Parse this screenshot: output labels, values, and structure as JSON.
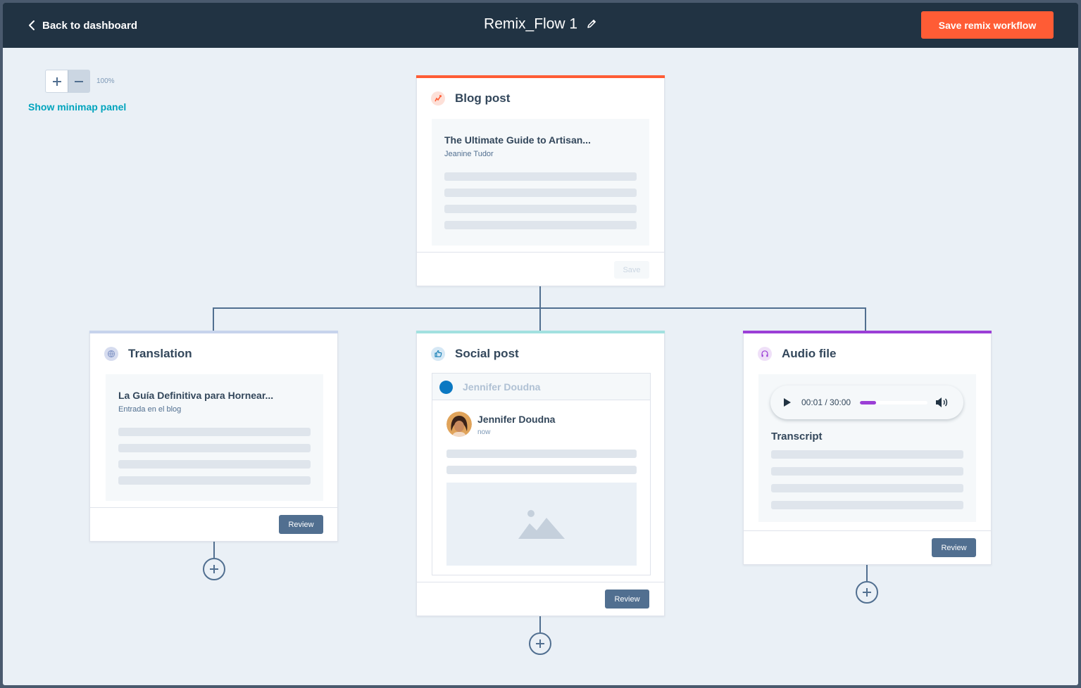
{
  "header": {
    "back_label": "Back to dashboard",
    "title": "Remix_Flow 1",
    "save_label": "Save remix workflow"
  },
  "canvas": {
    "zoom_level": "100%",
    "minimap_label": "Show minimap panel"
  },
  "cards": {
    "blog": {
      "title": "Blog post",
      "accent": "#ff5c35",
      "doc_title": "The Ultimate Guide to Artisan...",
      "doc_author": "Jeanine Tudor",
      "save_label": "Save"
    },
    "translation": {
      "title": "Translation",
      "accent": "#c7d3ec",
      "doc_title": "La Guía Definitiva para Hornear...",
      "doc_sub": "Entrada en el blog",
      "review_label": "Review"
    },
    "social": {
      "title": "Social post",
      "accent": "#a2e1e0",
      "account_name": "Jennifer Doudna",
      "post_author": "Jennifer Doudna",
      "post_time": "now",
      "review_label": "Review"
    },
    "audio": {
      "title": "Audio file",
      "accent": "#9b3fd6",
      "time": "00:01 / 30:00",
      "progress": 0.24,
      "transcript_label": "Transcript",
      "review_label": "Review"
    }
  },
  "colors": {
    "topbar": "#213343",
    "primary_button": "#ff5c35",
    "review_button": "#516f90",
    "link": "#00a4bd"
  }
}
